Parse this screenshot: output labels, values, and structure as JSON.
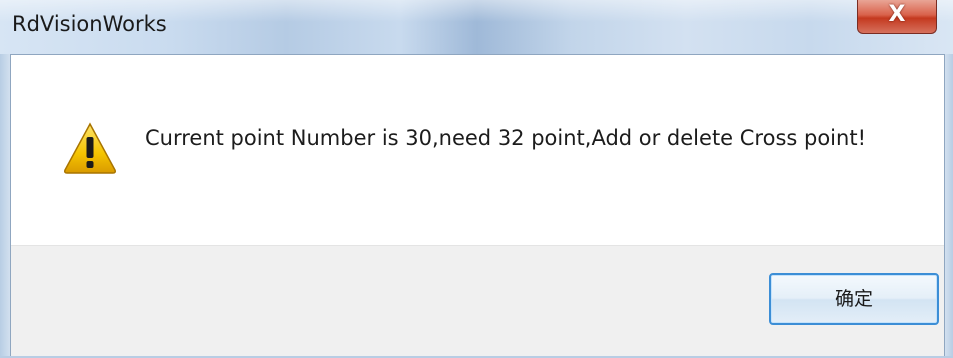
{
  "window": {
    "title": "RdVisionWorks",
    "close_label": "X"
  },
  "dialog": {
    "icon": "warning-icon",
    "message": "Current point Number is 30,need 32 point,Add or delete Cross point!",
    "ok_label": "确定"
  },
  "colors": {
    "ok_border": "#3c8ed6",
    "close_button": "#c4391f",
    "warning_fill": "#f5c400"
  }
}
